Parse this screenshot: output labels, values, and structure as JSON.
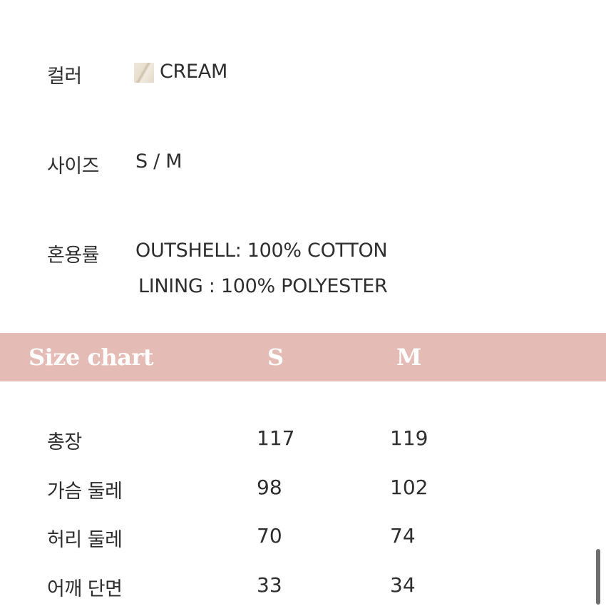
{
  "info": {
    "color_label": "컬러",
    "color_value": "CREAM",
    "size_label": "사이즈",
    "size_value": "S / M",
    "composition_label": "혼용률",
    "composition_line1": "OUTSHELL: 100% COTTON",
    "composition_line2": "LINING : 100% POLYESTER"
  },
  "size_chart": {
    "title": "Size chart",
    "columns": [
      "S",
      "M"
    ],
    "rows": [
      {
        "label": "총장",
        "s": "117",
        "m": "119"
      },
      {
        "label": "가슴 둘레",
        "s": "98",
        "m": "102"
      },
      {
        "label": "허리 둘레",
        "s": "70",
        "m": "74"
      },
      {
        "label": "어깨 단면",
        "s": "33",
        "m": "34"
      }
    ]
  },
  "colors": {
    "band": "#e5bbb6",
    "swatch": "cream"
  }
}
